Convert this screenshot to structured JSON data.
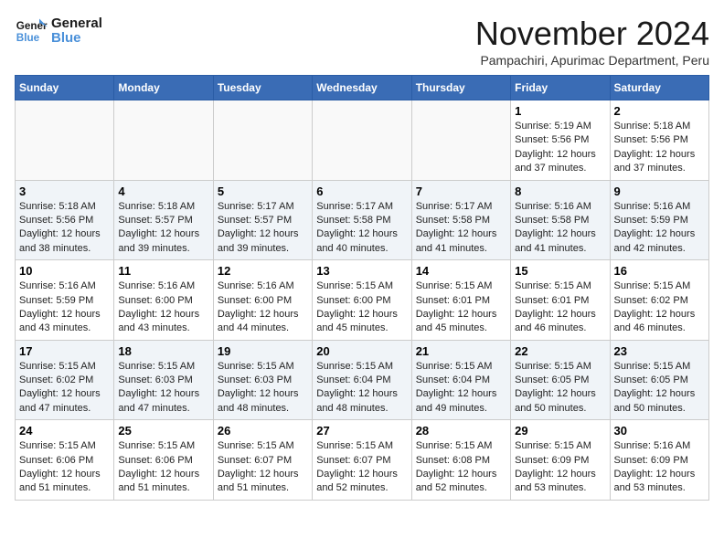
{
  "header": {
    "logo_line1": "General",
    "logo_line2": "Blue",
    "month_title": "November 2024",
    "subtitle": "Pampachiri, Apurimac Department, Peru"
  },
  "weekdays": [
    "Sunday",
    "Monday",
    "Tuesday",
    "Wednesday",
    "Thursday",
    "Friday",
    "Saturday"
  ],
  "weeks": [
    [
      {
        "day": "",
        "info": ""
      },
      {
        "day": "",
        "info": ""
      },
      {
        "day": "",
        "info": ""
      },
      {
        "day": "",
        "info": ""
      },
      {
        "day": "",
        "info": ""
      },
      {
        "day": "1",
        "info": "Sunrise: 5:19 AM\nSunset: 5:56 PM\nDaylight: 12 hours\nand 37 minutes."
      },
      {
        "day": "2",
        "info": "Sunrise: 5:18 AM\nSunset: 5:56 PM\nDaylight: 12 hours\nand 37 minutes."
      }
    ],
    [
      {
        "day": "3",
        "info": "Sunrise: 5:18 AM\nSunset: 5:56 PM\nDaylight: 12 hours\nand 38 minutes."
      },
      {
        "day": "4",
        "info": "Sunrise: 5:18 AM\nSunset: 5:57 PM\nDaylight: 12 hours\nand 39 minutes."
      },
      {
        "day": "5",
        "info": "Sunrise: 5:17 AM\nSunset: 5:57 PM\nDaylight: 12 hours\nand 39 minutes."
      },
      {
        "day": "6",
        "info": "Sunrise: 5:17 AM\nSunset: 5:58 PM\nDaylight: 12 hours\nand 40 minutes."
      },
      {
        "day": "7",
        "info": "Sunrise: 5:17 AM\nSunset: 5:58 PM\nDaylight: 12 hours\nand 41 minutes."
      },
      {
        "day": "8",
        "info": "Sunrise: 5:16 AM\nSunset: 5:58 PM\nDaylight: 12 hours\nand 41 minutes."
      },
      {
        "day": "9",
        "info": "Sunrise: 5:16 AM\nSunset: 5:59 PM\nDaylight: 12 hours\nand 42 minutes."
      }
    ],
    [
      {
        "day": "10",
        "info": "Sunrise: 5:16 AM\nSunset: 5:59 PM\nDaylight: 12 hours\nand 43 minutes."
      },
      {
        "day": "11",
        "info": "Sunrise: 5:16 AM\nSunset: 6:00 PM\nDaylight: 12 hours\nand 43 minutes."
      },
      {
        "day": "12",
        "info": "Sunrise: 5:16 AM\nSunset: 6:00 PM\nDaylight: 12 hours\nand 44 minutes."
      },
      {
        "day": "13",
        "info": "Sunrise: 5:15 AM\nSunset: 6:00 PM\nDaylight: 12 hours\nand 45 minutes."
      },
      {
        "day": "14",
        "info": "Sunrise: 5:15 AM\nSunset: 6:01 PM\nDaylight: 12 hours\nand 45 minutes."
      },
      {
        "day": "15",
        "info": "Sunrise: 5:15 AM\nSunset: 6:01 PM\nDaylight: 12 hours\nand 46 minutes."
      },
      {
        "day": "16",
        "info": "Sunrise: 5:15 AM\nSunset: 6:02 PM\nDaylight: 12 hours\nand 46 minutes."
      }
    ],
    [
      {
        "day": "17",
        "info": "Sunrise: 5:15 AM\nSunset: 6:02 PM\nDaylight: 12 hours\nand 47 minutes."
      },
      {
        "day": "18",
        "info": "Sunrise: 5:15 AM\nSunset: 6:03 PM\nDaylight: 12 hours\nand 47 minutes."
      },
      {
        "day": "19",
        "info": "Sunrise: 5:15 AM\nSunset: 6:03 PM\nDaylight: 12 hours\nand 48 minutes."
      },
      {
        "day": "20",
        "info": "Sunrise: 5:15 AM\nSunset: 6:04 PM\nDaylight: 12 hours\nand 48 minutes."
      },
      {
        "day": "21",
        "info": "Sunrise: 5:15 AM\nSunset: 6:04 PM\nDaylight: 12 hours\nand 49 minutes."
      },
      {
        "day": "22",
        "info": "Sunrise: 5:15 AM\nSunset: 6:05 PM\nDaylight: 12 hours\nand 50 minutes."
      },
      {
        "day": "23",
        "info": "Sunrise: 5:15 AM\nSunset: 6:05 PM\nDaylight: 12 hours\nand 50 minutes."
      }
    ],
    [
      {
        "day": "24",
        "info": "Sunrise: 5:15 AM\nSunset: 6:06 PM\nDaylight: 12 hours\nand 51 minutes."
      },
      {
        "day": "25",
        "info": "Sunrise: 5:15 AM\nSunset: 6:06 PM\nDaylight: 12 hours\nand 51 minutes."
      },
      {
        "day": "26",
        "info": "Sunrise: 5:15 AM\nSunset: 6:07 PM\nDaylight: 12 hours\nand 51 minutes."
      },
      {
        "day": "27",
        "info": "Sunrise: 5:15 AM\nSunset: 6:07 PM\nDaylight: 12 hours\nand 52 minutes."
      },
      {
        "day": "28",
        "info": "Sunrise: 5:15 AM\nSunset: 6:08 PM\nDaylight: 12 hours\nand 52 minutes."
      },
      {
        "day": "29",
        "info": "Sunrise: 5:15 AM\nSunset: 6:09 PM\nDaylight: 12 hours\nand 53 minutes."
      },
      {
        "day": "30",
        "info": "Sunrise: 5:16 AM\nSunset: 6:09 PM\nDaylight: 12 hours\nand 53 minutes."
      }
    ]
  ]
}
